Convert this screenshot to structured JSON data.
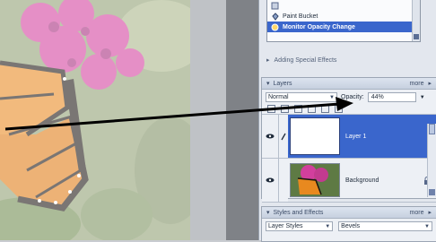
{
  "actions": {
    "items": [
      {
        "label": "",
        "icon": "action-item-icon"
      },
      {
        "label": "Paint Bucket",
        "icon": "paint-bucket-icon"
      },
      {
        "label": "Monitor Opacity Change",
        "icon": "action-step-icon",
        "selected": true
      }
    ],
    "footer_label": "Adding Special Effects"
  },
  "layers": {
    "title": "Layers",
    "more_label": "more",
    "blend_mode": "Normal",
    "opacity_label": "Opacity:",
    "opacity_value": "44%",
    "list": [
      {
        "name": "Layer 1",
        "selected": true,
        "thumb": "white"
      },
      {
        "name": "Background",
        "selected": false,
        "thumb": "photo",
        "locked": true
      }
    ]
  },
  "styles": {
    "title": "Styles and Effects",
    "more_label": "more",
    "category": "Layer Styles",
    "subcategory": "Bevels"
  },
  "colors": {
    "selection": "#3a66cc",
    "panel_bg": "#edf0f5",
    "monarch_orange": "#e8891f",
    "flower_pink": "#d23f9d"
  }
}
